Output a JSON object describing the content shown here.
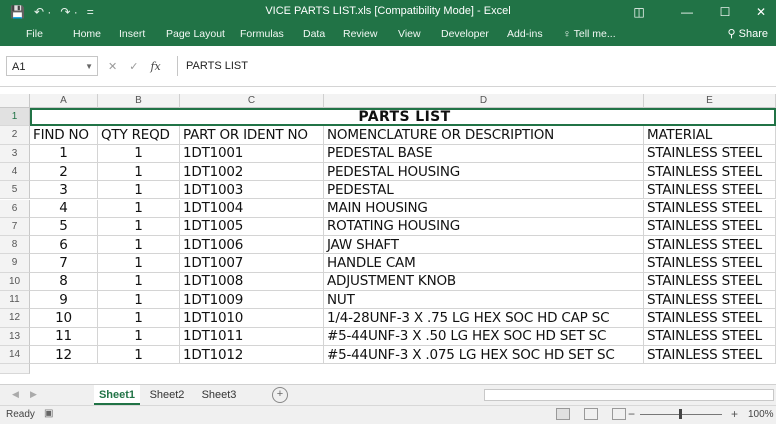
{
  "app": {
    "title": "VICE PARTS LIST.xls  [Compatibility Mode] - Excel",
    "qat": [
      "💾",
      "↶ ·",
      "↷ ·",
      "="
    ],
    "window_controls": [
      "◫",
      "—",
      "☐",
      "✕"
    ]
  },
  "ribbon": {
    "tabs": [
      "File",
      "Home",
      "Insert",
      "Page Layout",
      "Formulas",
      "Data",
      "Review",
      "View",
      "Developer",
      "Add-ins",
      "♀ Tell me..."
    ],
    "share_label": "Share",
    "share_icon": "user-icon"
  },
  "formula_bar": {
    "name_box": "A1",
    "cancel_symbol": "✕",
    "confirm_symbol": "✓",
    "fx_label": "fx",
    "content": "PARTS LIST"
  },
  "grid": {
    "columns": [
      "A",
      "B",
      "C",
      "D",
      "E"
    ],
    "row_numbers": [
      "1",
      "2",
      "3",
      "4",
      "5",
      "6",
      "7",
      "8",
      "9",
      "10",
      "11",
      "12",
      "13",
      "14"
    ],
    "title": "PARTS LIST",
    "headers": [
      "FIND NO",
      "QTY REQD",
      "PART OR IDENT NO",
      "NOMENCLATURE OR DESCRIPTION",
      "MATERIAL"
    ],
    "rows": [
      [
        "1",
        "1",
        "1DT1001",
        "PEDESTAL BASE",
        "STAINLESS STEEL"
      ],
      [
        "2",
        "1",
        "1DT1002",
        "PEDESTAL HOUSING",
        "STAINLESS STEEL"
      ],
      [
        "3",
        "1",
        "1DT1003",
        "PEDESTAL",
        "STAINLESS STEEL"
      ],
      [
        "4",
        "1",
        "1DT1004",
        "MAIN HOUSING",
        "STAINLESS STEEL"
      ],
      [
        "5",
        "1",
        "1DT1005",
        "ROTATING HOUSING",
        "STAINLESS STEEL"
      ],
      [
        "6",
        "1",
        "1DT1006",
        "JAW SHAFT",
        "STAINLESS STEEL"
      ],
      [
        "7",
        "1",
        "1DT1007",
        "HANDLE CAM",
        "STAINLESS STEEL"
      ],
      [
        "8",
        "1",
        "1DT1008",
        "ADJUSTMENT KNOB",
        "STAINLESS STEEL"
      ],
      [
        "9",
        "1",
        "1DT1009",
        "NUT",
        "STAINLESS STEEL"
      ],
      [
        "10",
        "1",
        "1DT1010",
        "1/4-28UNF-3 X .75 LG HEX SOC HD CAP SC",
        "STAINLESS STEEL"
      ],
      [
        "11",
        "1",
        "1DT1011",
        "#5-44UNF-3 X .50 LG HEX SOC HD SET SC",
        "STAINLESS STEEL"
      ],
      [
        "12",
        "1",
        "1DT1012",
        "#5-44UNF-3 X .075 LG HEX SOC HD SET SC",
        "STAINLESS STEEL"
      ]
    ]
  },
  "sheets": {
    "tabs": [
      "Sheet1",
      "Sheet2",
      "Sheet3"
    ],
    "active": "Sheet1",
    "add_symbol": "+"
  },
  "status": {
    "ready": "Ready",
    "zoom": "100%",
    "zoom_minus": "−",
    "zoom_plus": "+"
  },
  "colors": {
    "accent": "#217346"
  }
}
